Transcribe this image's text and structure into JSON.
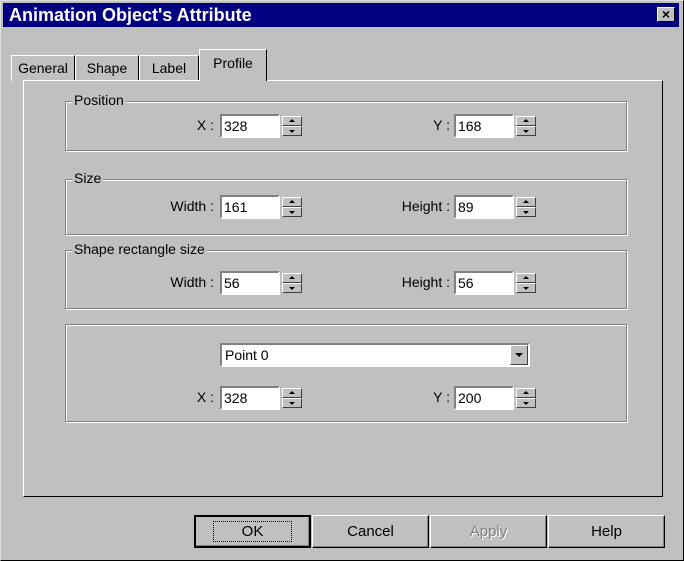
{
  "window": {
    "title": "Animation Object's Attribute",
    "close_glyph": "×"
  },
  "tabs": [
    {
      "label": "General"
    },
    {
      "label": "Shape"
    },
    {
      "label": "Label"
    },
    {
      "label": "Profile",
      "active": true
    }
  ],
  "position": {
    "legend": "Position",
    "x_label": "X :",
    "x_value": "328",
    "y_label": "Y :",
    "y_value": "168"
  },
  "size": {
    "legend": "Size",
    "width_label": "Width :",
    "width_value": "161",
    "height_label": "Height :",
    "height_value": "89"
  },
  "shape_rect": {
    "legend": "Shape rectangle size",
    "width_label": "Width :",
    "width_value": "56",
    "height_label": "Height :",
    "height_value": "56"
  },
  "point": {
    "selected": "Point 0",
    "x_label": "X :",
    "x_value": "328",
    "y_label": "Y :",
    "y_value": "200"
  },
  "buttons": {
    "ok": "OK",
    "cancel": "Cancel",
    "apply": "Apply",
    "help": "Help"
  }
}
